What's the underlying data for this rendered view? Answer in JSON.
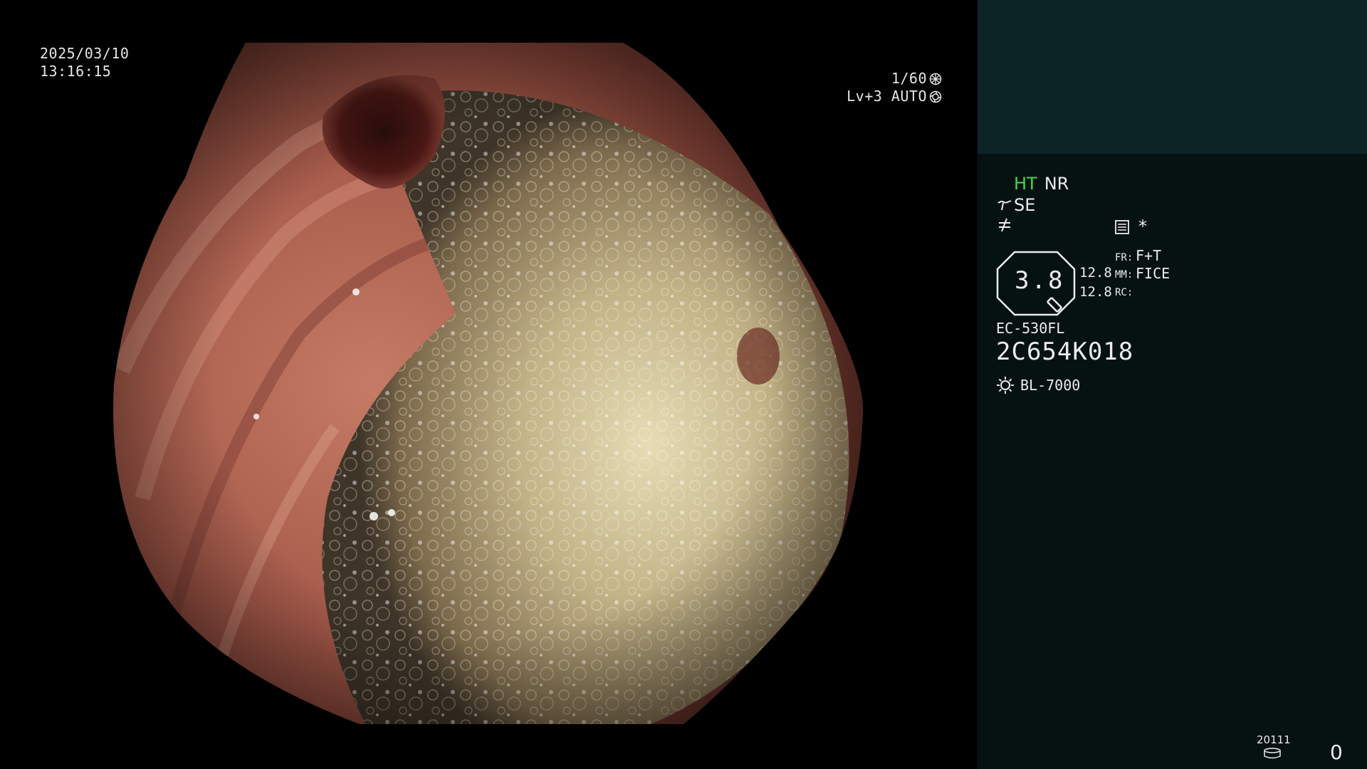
{
  "osd": {
    "date": "2025/03/10",
    "time": "13:16:15",
    "shutter": "1/60",
    "iris": "Lv+3 AUTO"
  },
  "panel": {
    "mode_ht": "HT",
    "mode_nr": "NR",
    "se": "SE",
    "slash": "≁",
    "star": "*",
    "zoom_value": "3.8",
    "num1": "12.8",
    "num2": "12.8",
    "fr_label": "FR:",
    "fr_value": "F+T",
    "mm_label": "MM:",
    "mm_value": "FICE",
    "rc_label": "RC:",
    "model": "EC-530FL",
    "serial": "2C654K018",
    "light_source": "BL-7000",
    "record_count": "20111",
    "record_index": "0"
  },
  "colors": {
    "panel_top": "#0c2426",
    "panel": "#061112",
    "ht_green": "#3fdc4a"
  }
}
